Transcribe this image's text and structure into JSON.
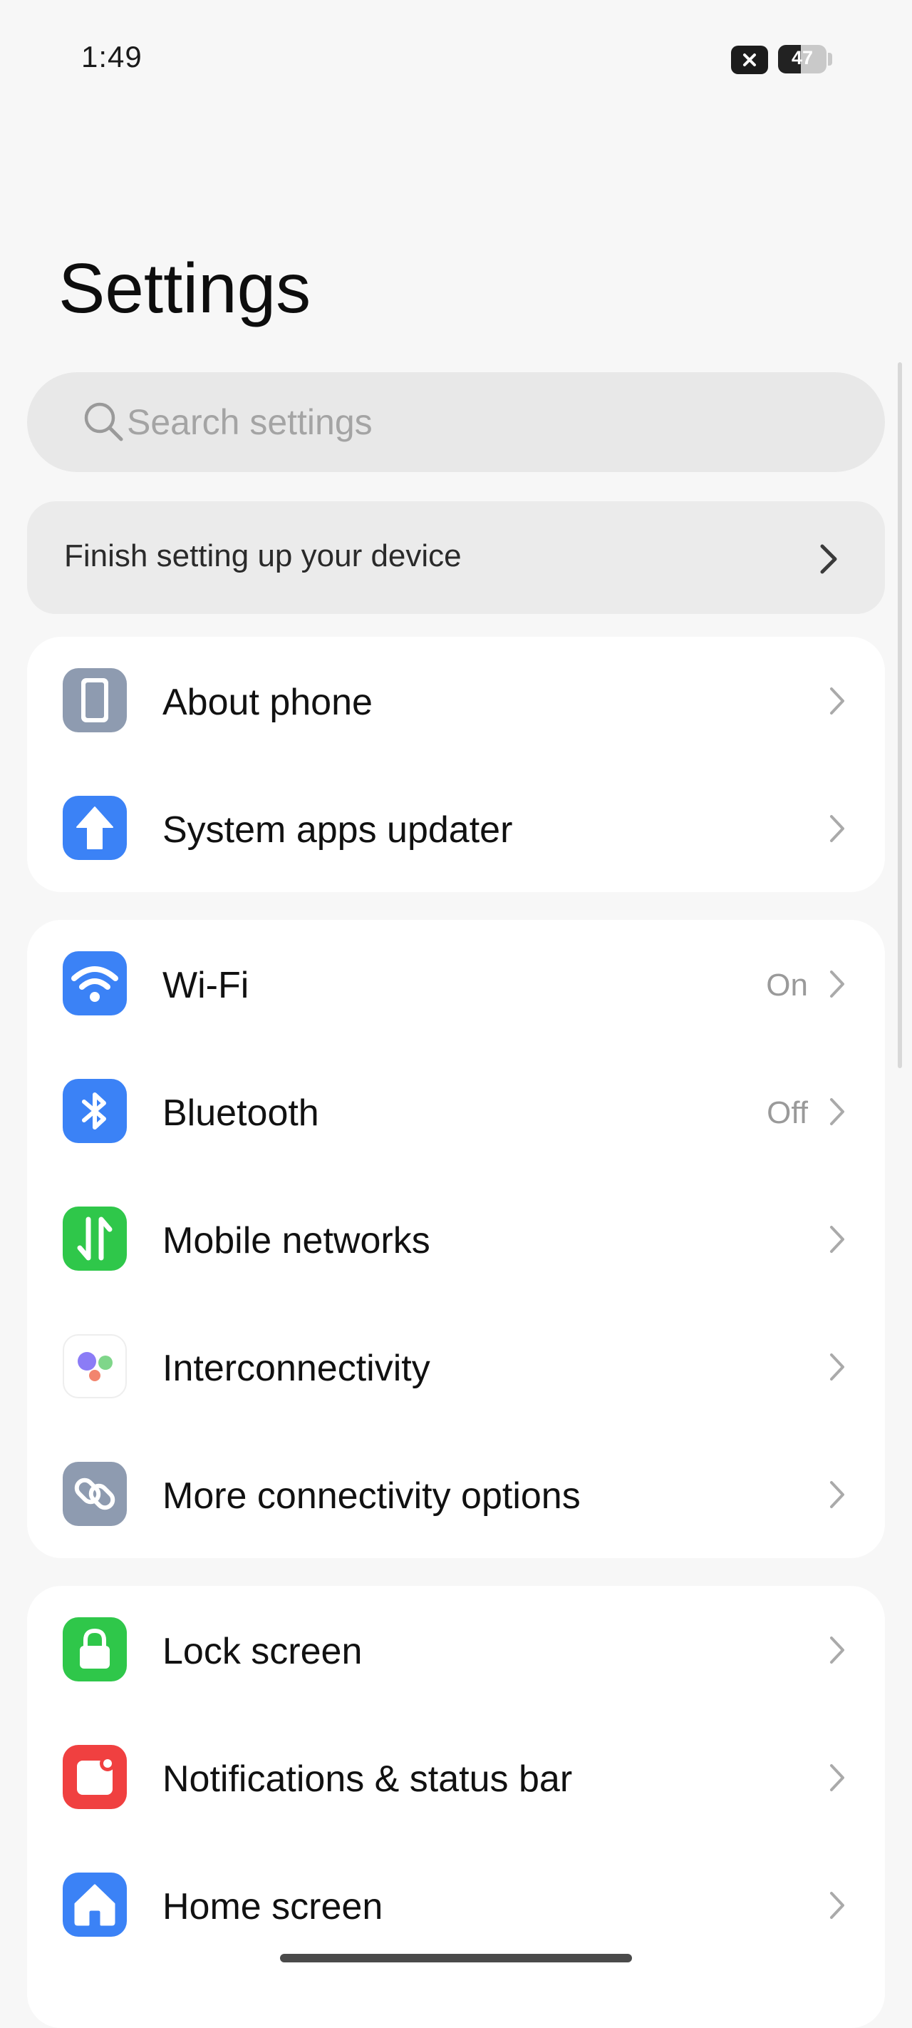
{
  "status_bar": {
    "time": "1:49",
    "battery_level": "47",
    "battery_fraction": 0.47
  },
  "title": "Settings",
  "search": {
    "placeholder": "Search settings",
    "value": ""
  },
  "setup_banner": {
    "label": "Finish setting up your device"
  },
  "groups": [
    {
      "items": [
        {
          "label": "About phone",
          "value": "",
          "icon": "phone-icon",
          "color": "#8e9bb0"
        },
        {
          "label": "System apps updater",
          "value": "",
          "icon": "arrow-up-icon",
          "color": "#3b82f6"
        }
      ]
    },
    {
      "items": [
        {
          "label": "Wi-Fi",
          "value": "On",
          "icon": "wifi-icon",
          "color": "#3b82f6"
        },
        {
          "label": "Bluetooth",
          "value": "Off",
          "icon": "bluetooth-icon",
          "color": "#3b82f6"
        },
        {
          "label": "Mobile networks",
          "value": "",
          "icon": "mobile-data-icon",
          "color": "#2fc74a"
        },
        {
          "label": "Interconnectivity",
          "value": "",
          "icon": "interconnectivity-icon",
          "color": "#ffffff"
        },
        {
          "label": "More connectivity options",
          "value": "",
          "icon": "link-icon",
          "color": "#8e9bb0"
        }
      ]
    },
    {
      "items": [
        {
          "label": "Lock screen",
          "value": "",
          "icon": "lock-icon",
          "color": "#2fc74a"
        },
        {
          "label": "Notifications & status bar",
          "value": "",
          "icon": "notification-icon",
          "color": "#f04040"
        },
        {
          "label": "Home screen",
          "value": "",
          "icon": "home-icon",
          "color": "#3b82f6"
        }
      ]
    }
  ]
}
